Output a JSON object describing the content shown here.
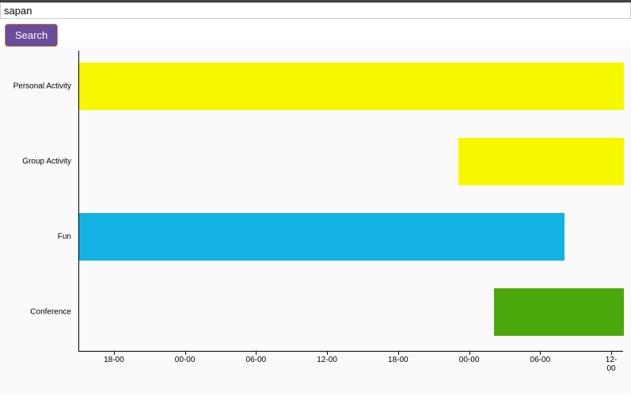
{
  "search": {
    "value": "sapan",
    "button_label": "Search"
  },
  "chart_data": {
    "type": "bar",
    "orientation": "horizontal",
    "categories": [
      "Personal Activity",
      "Group Activity",
      "Fun",
      "Conference"
    ],
    "x_ticks": [
      "18-00",
      "00-00",
      "06-00",
      "12-00",
      "18-00",
      "00-00",
      "06-00",
      "12-00"
    ],
    "x_range_hours": [
      15,
      61
    ],
    "bars": [
      {
        "category": "Personal Activity",
        "start_hour": 15,
        "end_hour": 61,
        "color": "#f7f700"
      },
      {
        "category": "Group Activity",
        "start_hour": 47,
        "end_hour": 61,
        "color": "#f7f700"
      },
      {
        "category": "Fun",
        "start_hour": 15,
        "end_hour": 56,
        "color": "#12b2e4"
      },
      {
        "category": "Conference",
        "start_hour": 50,
        "end_hour": 61,
        "color": "#4aa80c"
      }
    ]
  }
}
